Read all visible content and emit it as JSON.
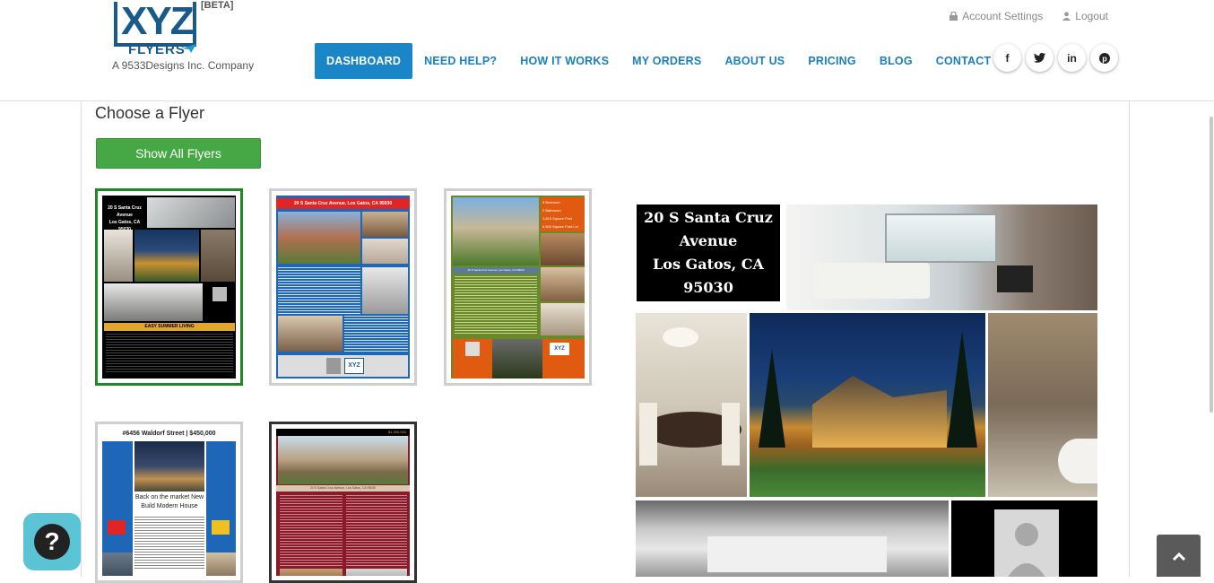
{
  "header": {
    "logo": {
      "mark": "XYZ",
      "flyers": "FLYERS",
      "beta": "[BETA]",
      "tagline": "A 9533Designs Inc. Company"
    },
    "account_settings": "Account Settings",
    "logout": "Logout",
    "nav": [
      {
        "label": "DASHBOARD",
        "active": true
      },
      {
        "label": "NEED HELP?"
      },
      {
        "label": "HOW IT WORKS"
      },
      {
        "label": "MY ORDERS"
      },
      {
        "label": "ABOUT US"
      },
      {
        "label": "PRICING"
      },
      {
        "label": "BLOG"
      },
      {
        "label": "CONTACT"
      }
    ],
    "social": [
      {
        "icon": "facebook-icon",
        "glyph": "f"
      },
      {
        "icon": "twitter-icon",
        "glyph": "t"
      },
      {
        "icon": "linkedin-icon",
        "glyph": "in"
      },
      {
        "icon": "pinterest-icon",
        "glyph": "p"
      }
    ]
  },
  "main": {
    "title": "Choose a Flyer",
    "show_all": "Show All Flyers",
    "flyers": [
      {
        "address": "20 S Santa Cruz Avenue",
        "city": "Los Gatos, CA 95030",
        "banner": "EASY SUMMER LIVING",
        "selected": true
      },
      {
        "address": "20 S Santa Cruz Avenue, Los Gatos, CA 95030"
      },
      {
        "beds": "3 Bedroom",
        "baths": "2 Bathroom",
        "sqft": "1,615 Square Feet",
        "lot": "6,500 Square Foot Lot",
        "address": "20 S Santa Cruz Avenue, Los Gatos, CA 95030"
      },
      {
        "headline": "#6456 Waldorf Street | $450,000",
        "tagline": "Back on the market New Build Modern House"
      },
      {
        "price": "$1,350,000",
        "address": "20 S Santa Cruz Avenue, Los Gatos, CA 95030"
      }
    ],
    "preview": {
      "address": "20 S Santa Cruz Avenue",
      "city": "Los Gatos, CA 95030"
    }
  },
  "colors": {
    "accent": "#1a86c8",
    "green": "#45a844",
    "selected_border": "#1f8a25"
  }
}
